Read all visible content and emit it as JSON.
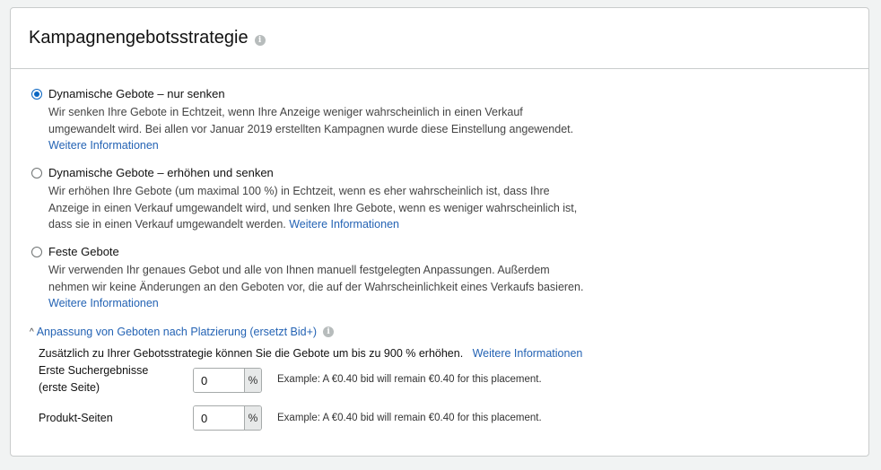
{
  "card": {
    "title": "Kampagnengebotsstrategie"
  },
  "options": [
    {
      "label": "Dynamische Gebote – nur senken",
      "selected": true,
      "description": "Wir senken Ihre Gebote in Echtzeit, wenn Ihre Anzeige weniger wahrscheinlich in einen Verkauf umgewandelt wird. Bei allen vor Januar 2019 erstellten Kampagnen wurde diese Einstellung angewendet.",
      "link": "Weitere Informationen"
    },
    {
      "label": "Dynamische Gebote – erhöhen und senken",
      "selected": false,
      "description": "Wir erhöhen Ihre Gebote (um maximal 100 %) in Echtzeit, wenn es eher wahrscheinlich ist, dass Ihre Anzeige in einen Verkauf umgewandelt wird, und senken Ihre Gebote, wenn es weniger wahrscheinlich ist, dass sie in einen Verkauf umgewandelt werden.",
      "link": "Weitere Informationen"
    },
    {
      "label": "Feste Gebote",
      "selected": false,
      "description": "Wir verwenden Ihr genaues Gebot und alle von Ihnen manuell festgelegten Anpassungen. Außerdem nehmen wir keine Änderungen an den Geboten vor, die auf der Wahrscheinlichkeit eines Verkaufs basieren.",
      "link": "Weitere Informationen"
    }
  ],
  "adjustment": {
    "toggle_label": "Anpassung von Geboten nach Platzierung (ersetzt Bid+)",
    "intro": "Zusätzlich zu Ihrer Gebotsstrategie können Sie die Gebote um bis zu 900 % erhöhen.",
    "link": "Weitere Informationen",
    "rows": [
      {
        "label_line1": "Erste Suchergebnisse",
        "label_line2": "(erste Seite)",
        "value": "0",
        "suffix": "%",
        "example": "Example: A €0.40 bid will remain €0.40 for this placement."
      },
      {
        "label_line1": "Produkt-Seiten",
        "value": "0",
        "suffix": "%",
        "example": "Example: A €0.40 bid will remain €0.40 for this placement."
      }
    ]
  }
}
